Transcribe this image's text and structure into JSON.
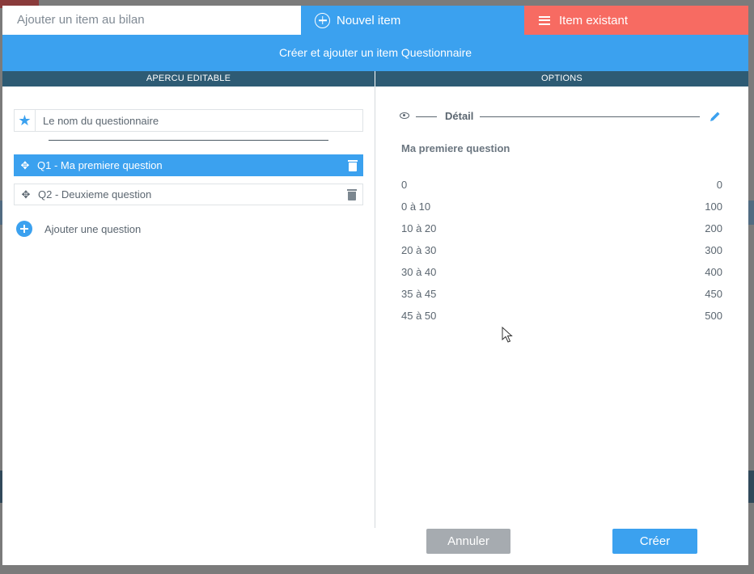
{
  "modal": {
    "title": "Ajouter un item au bilan",
    "tab_new": "Nouvel item",
    "tab_existing": "Item existant",
    "banner": "Créer et ajouter un item Questionnaire",
    "left_section": "APERCU EDITABLE",
    "right_section": "OPTIONS"
  },
  "colors": {
    "accent": "#3ba1ef",
    "danger": "#f76b62",
    "section_bar": "#2e5b74",
    "text": "#5b6670",
    "cancel": "#a6abb0"
  },
  "editor": {
    "name_placeholder": "Le nom du questionnaire",
    "questions": [
      {
        "label": "Q1 - Ma premiere question",
        "selected": true
      },
      {
        "label": "Q2 - Deuxieme question",
        "selected": false
      }
    ],
    "add_question": "Ajouter une question"
  },
  "options": {
    "detail_label": "Détail",
    "question_title": "Ma premiere question",
    "rows": [
      {
        "range": "0",
        "value": "0"
      },
      {
        "range": "0 à 10",
        "value": "100"
      },
      {
        "range": "10 à 20",
        "value": "200"
      },
      {
        "range": "20 à 30",
        "value": "300"
      },
      {
        "range": "30 à 40",
        "value": "400"
      },
      {
        "range": "35 à 45",
        "value": "450"
      },
      {
        "range": "45 à 50",
        "value": "500"
      }
    ]
  },
  "actions": {
    "cancel": "Annuler",
    "create": "Créer"
  },
  "icons": {
    "new_item": "plus-circle-icon",
    "existing_item": "menu-icon",
    "name": "star-icon",
    "drag": "move-icon",
    "delete": "trash-icon",
    "add_question": "plus-circle-icon",
    "detail_view": "eye-icon",
    "edit": "pencil-icon"
  }
}
